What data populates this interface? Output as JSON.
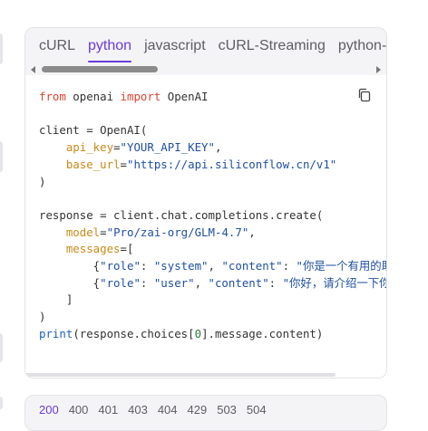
{
  "tabs": [
    {
      "label": "cURL",
      "active": false
    },
    {
      "label": "python",
      "active": true
    },
    {
      "label": "javascript",
      "active": false
    },
    {
      "label": "cURL-Streaming",
      "active": false
    },
    {
      "label": "python-Stre",
      "active": false
    }
  ],
  "copy_icon": "copy-icon",
  "code_lines": [
    [
      {
        "t": "from",
        "c": "kw"
      },
      {
        "t": " openai ",
        "c": ""
      },
      {
        "t": "import",
        "c": "kw"
      },
      {
        "t": " OpenAI",
        "c": ""
      }
    ],
    [],
    [
      {
        "t": "client = OpenAI(",
        "c": ""
      }
    ],
    [
      {
        "t": "    ",
        "c": ""
      },
      {
        "t": "api_key",
        "c": "arg"
      },
      {
        "t": "=",
        "c": ""
      },
      {
        "t": "\"YOUR_API_KEY\"",
        "c": "str"
      },
      {
        "t": ",",
        "c": ""
      }
    ],
    [
      {
        "t": "    ",
        "c": ""
      },
      {
        "t": "base_url",
        "c": "arg"
      },
      {
        "t": "=",
        "c": ""
      },
      {
        "t": "\"https://api.siliconflow.cn/v1\"",
        "c": "str"
      }
    ],
    [
      {
        "t": ")",
        "c": ""
      }
    ],
    [],
    [
      {
        "t": "response = client.chat.completions.create(",
        "c": ""
      }
    ],
    [
      {
        "t": "    ",
        "c": ""
      },
      {
        "t": "model",
        "c": "arg"
      },
      {
        "t": "=",
        "c": ""
      },
      {
        "t": "\"Pro/zai-org/GLM-4.7\"",
        "c": "str"
      },
      {
        "t": ",",
        "c": ""
      }
    ],
    [
      {
        "t": "    ",
        "c": ""
      },
      {
        "t": "messages",
        "c": "arg"
      },
      {
        "t": "=[",
        "c": ""
      }
    ],
    [
      {
        "t": "        {",
        "c": ""
      },
      {
        "t": "\"role\"",
        "c": "str"
      },
      {
        "t": ": ",
        "c": ""
      },
      {
        "t": "\"system\"",
        "c": "str"
      },
      {
        "t": ", ",
        "c": ""
      },
      {
        "t": "\"content\"",
        "c": "str"
      },
      {
        "t": ": ",
        "c": ""
      },
      {
        "t": "\"你是一个有用的助",
        "c": "str"
      }
    ],
    [
      {
        "t": "        {",
        "c": ""
      },
      {
        "t": "\"role\"",
        "c": "str"
      },
      {
        "t": ": ",
        "c": ""
      },
      {
        "t": "\"user\"",
        "c": "str"
      },
      {
        "t": ", ",
        "c": ""
      },
      {
        "t": "\"content\"",
        "c": "str"
      },
      {
        "t": ": ",
        "c": ""
      },
      {
        "t": "\"你好，请介绍一下你",
        "c": "str"
      }
    ],
    [
      {
        "t": "    ]",
        "c": ""
      }
    ],
    [
      {
        "t": ")",
        "c": ""
      }
    ],
    [
      {
        "t": "print",
        "c": "fn"
      },
      {
        "t": "(response.choices[",
        "c": ""
      },
      {
        "t": "0",
        "c": "num"
      },
      {
        "t": "].message.content)",
        "c": ""
      }
    ]
  ],
  "status_tabs": [
    {
      "label": "200",
      "active": true
    },
    {
      "label": "400",
      "active": false
    },
    {
      "label": "401",
      "active": false
    },
    {
      "label": "403",
      "active": false
    },
    {
      "label": "404",
      "active": false
    },
    {
      "label": "429",
      "active": false
    },
    {
      "label": "503",
      "active": false
    },
    {
      "label": "504",
      "active": false
    }
  ]
}
